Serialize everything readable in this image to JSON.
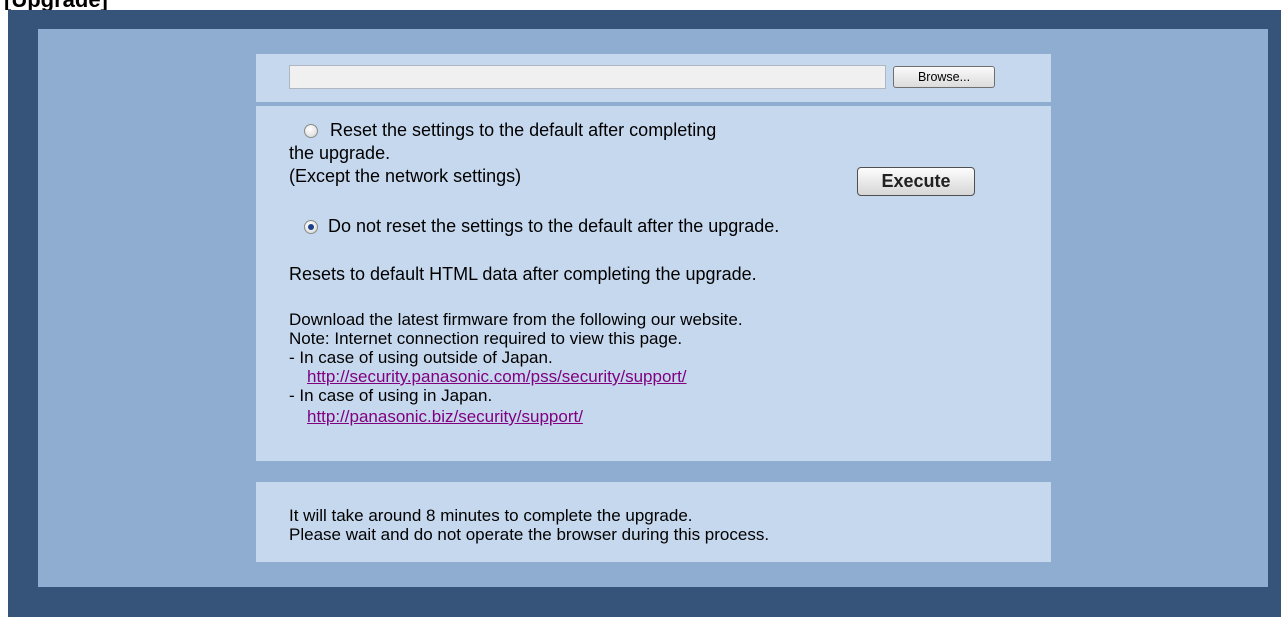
{
  "header": {
    "title": "[Upgrade]"
  },
  "file_select": {
    "value": "",
    "browse_label": "Browse..."
  },
  "reset_options": {
    "option_reset": {
      "line1": "Reset the settings to the default after completing",
      "line2": "the upgrade.",
      "line3": "(Except the network settings)",
      "checked": false
    },
    "option_no_reset": {
      "label": "Do not reset the settings to the default after the upgrade.",
      "checked": true
    },
    "execute_label": "Execute"
  },
  "html_reset_text": "Resets to default HTML data after completing the upgrade.",
  "download": {
    "line1": "Download the latest firmware from the following our website.",
    "line2": "Note: Internet connection required to view this page.",
    "outside_label": "- In case of using outside of Japan.",
    "outside_link": "http://security.panasonic.com/pss/security/support/",
    "japan_label": "- In case of using in Japan.",
    "japan_link": "http://panasonic.biz/security/support/"
  },
  "note": {
    "line1": "It will take around 8 minutes to complete the upgrade.",
    "line2": "Please wait and do not operate the browser during this process."
  },
  "colors": {
    "frame": "#365479",
    "inner": "#8facd1",
    "panel": "#c6d8ee",
    "link": "#800080"
  }
}
